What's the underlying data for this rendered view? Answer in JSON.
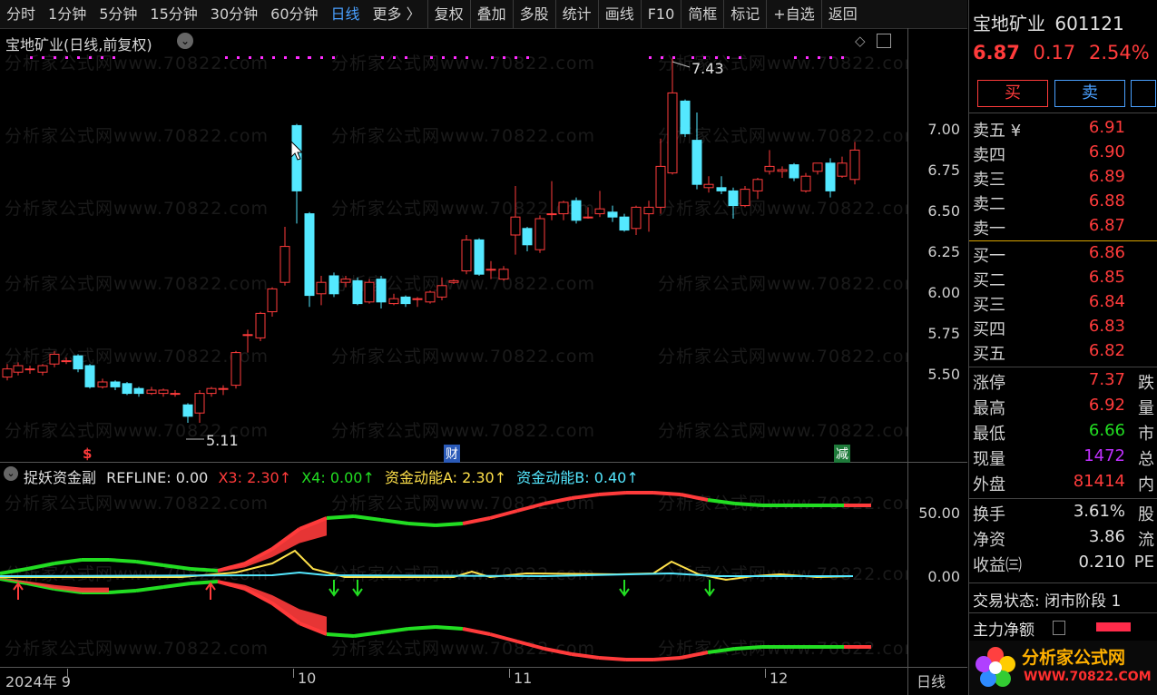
{
  "toolbar": {
    "tabs": [
      "分时",
      "1分钟",
      "5分钟",
      "15分钟",
      "30分钟",
      "60分钟",
      "日线",
      "更多 〉"
    ],
    "actions": [
      "复权",
      "叠加",
      "多股",
      "统计",
      "画线",
      "F10",
      "简框",
      "标记",
      "+自选",
      "返回"
    ]
  },
  "main_chart": {
    "title": "宝地矿业(日线,前复权)",
    "y_ticks": [
      "7.00",
      "6.75",
      "6.50",
      "6.25",
      "6.00",
      "5.75",
      "5.50"
    ],
    "high_label": "7.43",
    "low_label": "5.11",
    "event_markers": [
      "$",
      "财",
      "减"
    ]
  },
  "indicator": {
    "name": "捉妖资金副",
    "refline": "REFLINE: 0.00",
    "x3": "X3: 2.30↑",
    "x4": "X4: 0.00↑",
    "fa": "资金动能A: 2.30↑",
    "fb": "资金动能B: 0.40↑",
    "y_ticks": [
      "50.00",
      "0.00"
    ]
  },
  "x_axis": {
    "labels": [
      "2024年 9",
      "10",
      "11",
      "12"
    ],
    "period": "日线"
  },
  "watermark": "分析家公式网www.70822.com",
  "stock": {
    "name": "宝地矿业",
    "code": "601121",
    "price": "6.87",
    "change": "0.17",
    "pct": "2.54%"
  },
  "trade": {
    "buy": "买",
    "sell": "卖"
  },
  "orderbook": {
    "asks": [
      {
        "label": "卖五 ¥",
        "price": "6.91"
      },
      {
        "label": "卖四",
        "price": "6.90"
      },
      {
        "label": "卖三",
        "price": "6.89"
      },
      {
        "label": "卖二",
        "price": "6.88"
      },
      {
        "label": "卖一",
        "price": "6.87"
      }
    ],
    "bids": [
      {
        "label": "买一",
        "price": "6.86"
      },
      {
        "label": "买二",
        "price": "6.85"
      },
      {
        "label": "买三",
        "price": "6.84"
      },
      {
        "label": "买四",
        "price": "6.83"
      },
      {
        "label": "买五",
        "price": "6.82"
      }
    ]
  },
  "stats": [
    {
      "label": "涨停",
      "value": "7.37",
      "tail": "跌"
    },
    {
      "label": "最高",
      "value": "6.92",
      "tail": "量"
    },
    {
      "label": "最低",
      "value": "6.66",
      "tail": "市"
    },
    {
      "label": "现量",
      "value": "1472",
      "tail": "总"
    },
    {
      "label": "外盘",
      "value": "81414",
      "tail": "内"
    }
  ],
  "stats2": [
    {
      "label": "换手",
      "value": "3.61%",
      "tail": "股"
    },
    {
      "label": "净资",
      "value": "3.86",
      "tail": "流"
    },
    {
      "label": "收益㈢",
      "value": "0.210",
      "tail": "PE"
    }
  ],
  "status": {
    "label": "交易状态:",
    "value": "闭市阶段 1"
  },
  "main_net": {
    "label": "主力净额"
  },
  "brand": {
    "name": "分析家公式网",
    "url": "WWW.70822.COM"
  },
  "colors": {
    "up": "#ff3b3b",
    "down": "#54e8ff",
    "green": "#22dd22",
    "yellow": "#ffe14a",
    "magenta": "#ff2bff"
  }
}
